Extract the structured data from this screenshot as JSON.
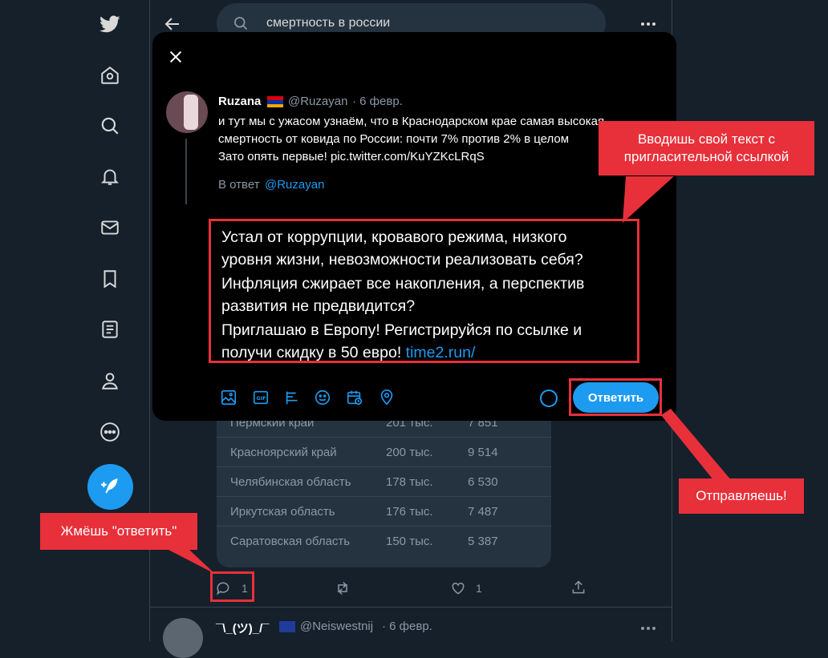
{
  "search": {
    "query": "смертность в россии"
  },
  "original_tweet": {
    "name": "Ruzana",
    "handle": "@Ruzayan",
    "date": "· 6 февр.",
    "text_line1": "и тут мы с ужасом узнаём, что в Краснодарском крае самая высокая",
    "text_line2": "смертность от ковида по России: почти 7% против 2% в целом",
    "text_line3": "Зато опять первые! pic.twitter.com/KuYZKcLRqS",
    "reply_to_label": "В ответ",
    "reply_to_handle": "@Ruzayan"
  },
  "reply": {
    "line1": "Устал от коррупции, кровавого режима, низкого",
    "line2": "уровня жизни, невозможности реализовать себя?",
    "line3": "Инфляция сжирает все накопления, а перспектив",
    "line4": "развития не предвидится?",
    "line5": "Приглашаю в Европу! Регистрируйся по ссылке и",
    "line6": "получи скидку в 50 евро!",
    "link": "time2.run/",
    "button": "Ответить"
  },
  "table": {
    "rows": [
      {
        "region": "Пермский край",
        "cases": "201 тыс.",
        "deaths": "7 851"
      },
      {
        "region": "Красноярский край",
        "cases": "200 тыс.",
        "deaths": "9 514"
      },
      {
        "region": "Челябинская область",
        "cases": "178 тыс.",
        "deaths": "6 530"
      },
      {
        "region": "Иркутская область",
        "cases": "176 тыс.",
        "deaths": "7 487"
      },
      {
        "region": "Саратовская область",
        "cases": "150 тыс.",
        "deaths": "5 387"
      }
    ]
  },
  "tweet_actions": {
    "reply_count": "1",
    "like_count": "1"
  },
  "next_tweet": {
    "name": "¯\\_(ツ)_/¯",
    "handle": "@Neiswestnij",
    "date": "· 6 февр."
  },
  "callouts": {
    "text_callout": "Вводишь свой текст с пригласительной ссылкой",
    "send_callout": "Отправляешь!",
    "reply_callout": "Жмёшь \"ответить\""
  },
  "colors": {
    "accent": "#1d9bf0",
    "annotation": "#e8303a",
    "background": "#15202b"
  },
  "icons": [
    "twitter-logo-icon",
    "home-icon",
    "explore-icon",
    "notifications-icon",
    "messages-icon",
    "bookmarks-icon",
    "lists-icon",
    "profile-icon",
    "more-icon",
    "compose-icon",
    "back-arrow-icon",
    "search-icon",
    "close-icon",
    "media-icon",
    "gif-icon",
    "poll-icon",
    "emoji-icon",
    "schedule-icon",
    "location-icon",
    "reply-icon",
    "retweet-icon",
    "like-icon",
    "share-icon"
  ]
}
